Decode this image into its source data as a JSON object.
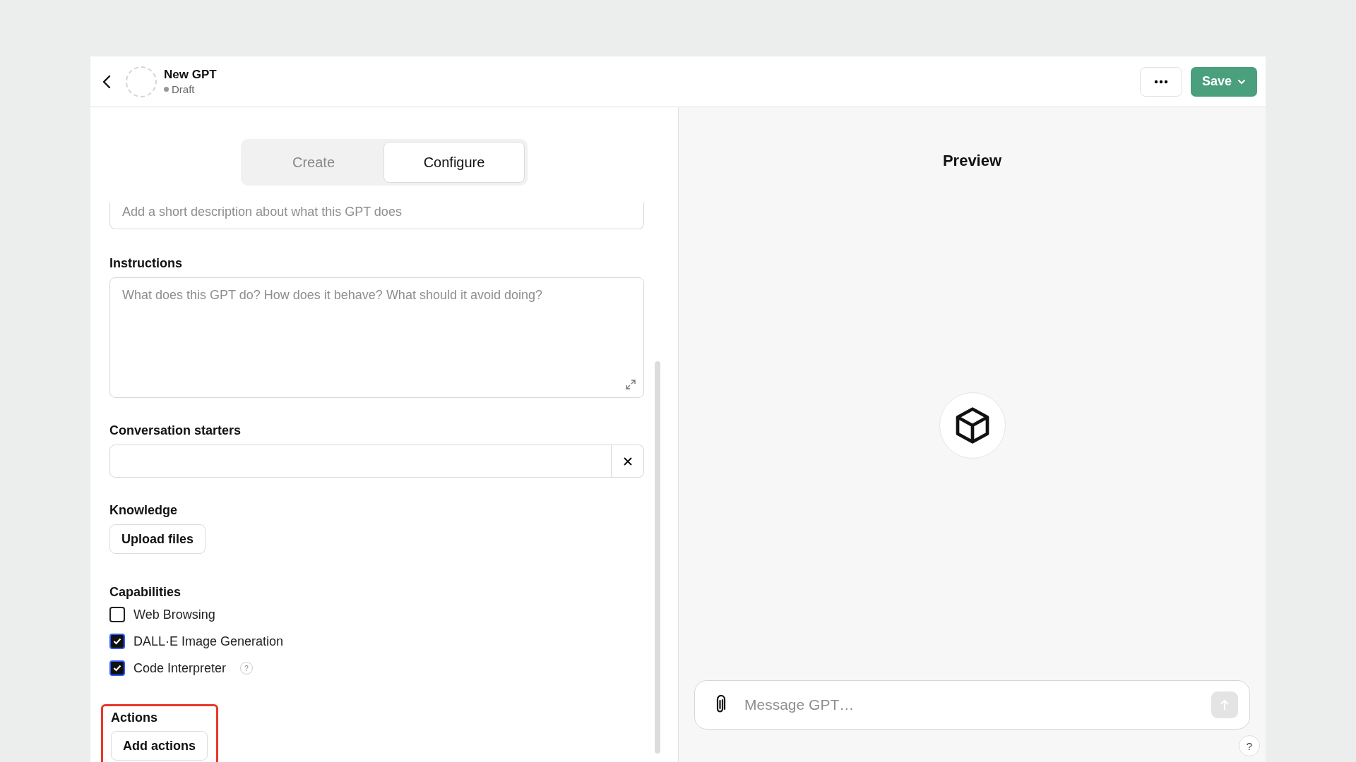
{
  "header": {
    "title": "New GPT",
    "status": "Draft",
    "save_label": "Save"
  },
  "tabs": [
    {
      "label": "Create",
      "selected": false
    },
    {
      "label": "Configure",
      "selected": true
    }
  ],
  "description": {
    "placeholder": "Add a short description about what this GPT does"
  },
  "instructions": {
    "label": "Instructions",
    "placeholder": "What does this GPT do? How does it behave? What should it avoid doing?"
  },
  "conversation_starters": {
    "label": "Conversation starters"
  },
  "knowledge": {
    "label": "Knowledge",
    "button": "Upload files"
  },
  "capabilities": {
    "label": "Capabilities",
    "items": [
      {
        "label": "Web Browsing",
        "checked": false
      },
      {
        "label": "DALL·E Image Generation",
        "checked": true
      },
      {
        "label": "Code Interpreter",
        "checked": true,
        "help": "?"
      }
    ]
  },
  "actions": {
    "label": "Actions",
    "button": "Add actions",
    "highlighted": true
  },
  "preview": {
    "title": "Preview",
    "message_placeholder": "Message GPT…",
    "help": "?"
  }
}
